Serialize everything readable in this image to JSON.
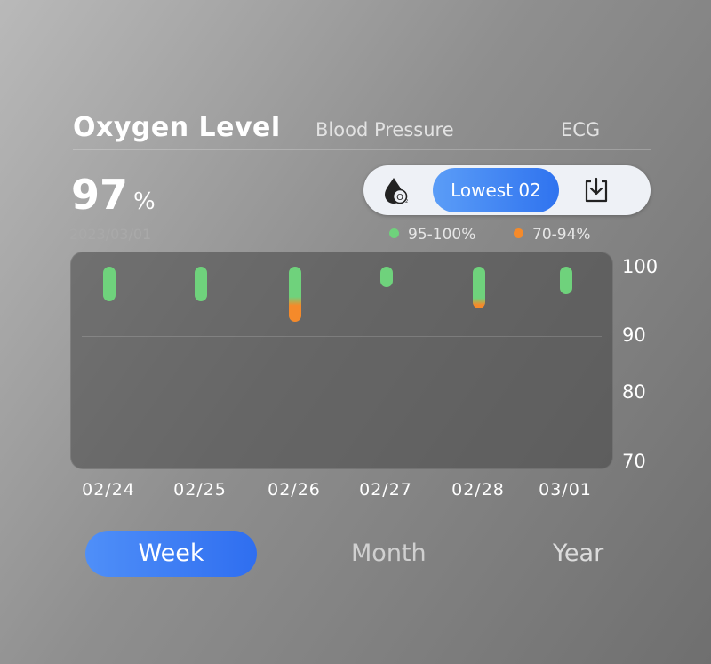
{
  "tabs": {
    "active": "Oxygen Level",
    "blood_pressure": "Blood Pressure",
    "ecg": "ECG"
  },
  "reading": {
    "value": "97",
    "unit": "%",
    "date": "2023/03/01"
  },
  "controls": {
    "oxygen_icon": "oxygen-drop-icon",
    "filter_label": "Lowest 02",
    "export_icon": "download-icon"
  },
  "legend": [
    {
      "label": "95-100%",
      "color": "#6fd27c"
    },
    {
      "label": "70-94%",
      "color": "#f58a2a"
    }
  ],
  "range_tabs": {
    "week": "Week",
    "month": "Month",
    "year": "Year"
  },
  "chart_data": {
    "type": "bar",
    "y_ticks": [
      "100",
      "90",
      "80",
      "70"
    ],
    "categories": [
      "02/24",
      "02/25",
      "02/26",
      "02/27",
      "02/28",
      "03/01"
    ],
    "ranges": [
      {
        "min": 95,
        "max": 100
      },
      {
        "min": 95,
        "max": 100
      },
      {
        "min": 92,
        "max": 100
      },
      {
        "min": 97,
        "max": 100
      },
      {
        "min": 94,
        "max": 100
      },
      {
        "min": 96,
        "max": 100
      }
    ],
    "ylim": [
      70,
      100
    ],
    "colors": {
      "normal": "#6fd27c",
      "low": "#f58a2a"
    }
  }
}
